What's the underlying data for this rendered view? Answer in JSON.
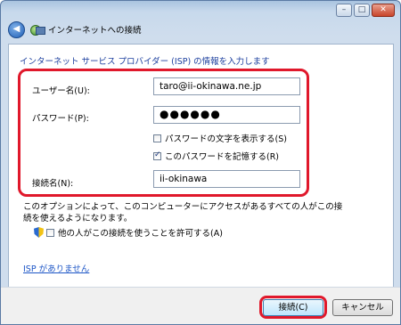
{
  "window": {
    "title": "インターネットへの接続",
    "minimize_glyph": "–",
    "maximize_glyph": "□",
    "close_glyph": "✕"
  },
  "instruction": "インターネット サービス プロバイダー (ISP) の情報を入力します",
  "form": {
    "username_label": "ユーザー名(U):",
    "username_value": "taro@ii-okinawa.ne.jp",
    "password_label": "パスワード(P):",
    "password_masked": "●●●●●●",
    "show_password_label": "パスワードの文字を表示する(S)",
    "show_password_checked": false,
    "remember_password_label": "このパスワードを記憶する(R)",
    "remember_password_checked": true,
    "connection_name_label": "接続名(N):",
    "connection_name_value": "ii-okinawa"
  },
  "note": "このオプションによって、このコンピューターにアクセスがあるすべての人がこの接続を使えるようになります。",
  "allow_others_label": "他の人がこの接続を使うことを許可する(A)",
  "allow_others_checked": false,
  "no_isp_link": "ISP がありません",
  "buttons": {
    "connect": "接続(C)",
    "cancel": "キャンセル"
  },
  "colors": {
    "highlight": "#e0182b",
    "instruction_text": "#1c3f9e",
    "link": "#1c55c6"
  }
}
